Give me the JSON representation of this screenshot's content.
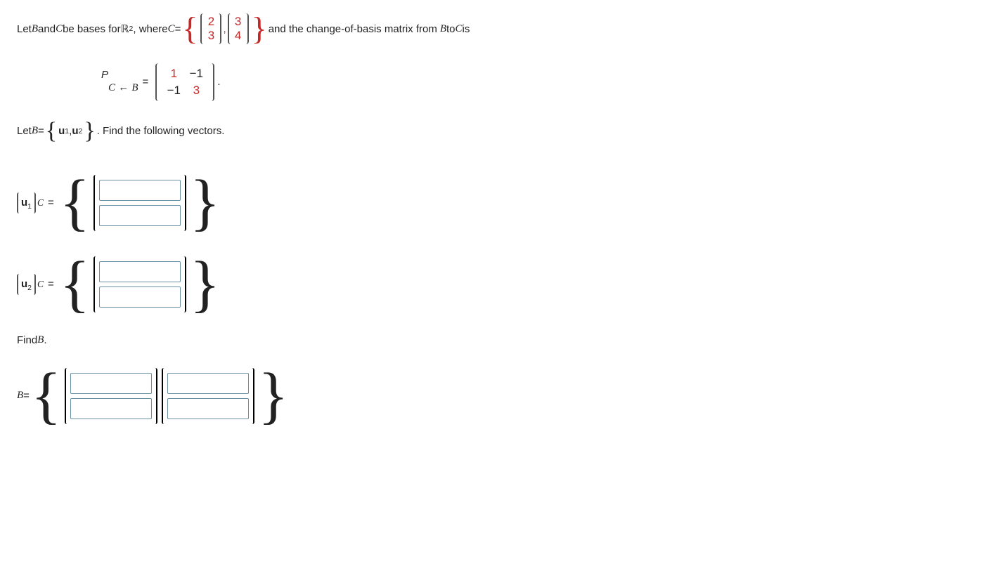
{
  "line1": {
    "t1": "Let ",
    "B": "B",
    "t2": " and ",
    "C": "C",
    "t3": " be bases for ",
    "R": "ℝ",
    "exp": "2",
    "t4": ", where ",
    "Ceq": "C",
    "eq": " = ",
    "c1a": "2",
    "c1b": "3",
    "c2a": "3",
    "c2b": "4",
    "t5": " and the change-of-basis matrix from ",
    "Bto": "B",
    "t6": " to ",
    "Cto": "C",
    "t7": " is"
  },
  "line2": {
    "P": "P",
    "CfromB_C": "C",
    "arrow": " ← ",
    "CfromB_B": "B",
    "eq": " = ",
    "m11": "1",
    "m12": "−1",
    "m21": "−1",
    "m22": "3",
    "dot": "."
  },
  "line3": {
    "t1": "Let ",
    "B": "B",
    "eq": " = ",
    "u1": "u",
    "u1sub": "1",
    "comma": ", ",
    "u2": "u",
    "u2sub": "2",
    "t2": ". Find the following vectors."
  },
  "u1c": {
    "u": "u",
    "sub": "1",
    "C": "C",
    "eq": "="
  },
  "u2c": {
    "u": "u",
    "sub": "2",
    "C": "C",
    "eq": "="
  },
  "findB": {
    "t": "Find ",
    "B": "B",
    "dot": "."
  },
  "Beq": {
    "B": "B",
    "eq": " = "
  }
}
